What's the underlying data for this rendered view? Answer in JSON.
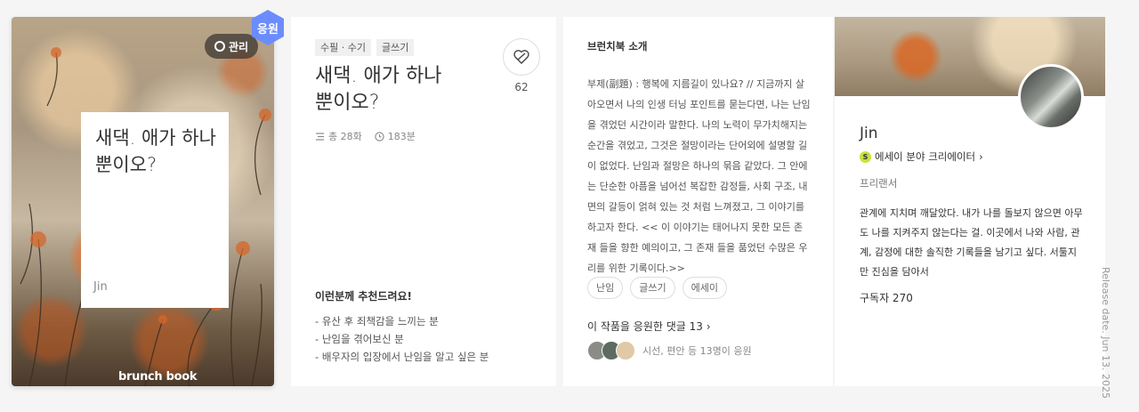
{
  "cover": {
    "manage_label": "관리",
    "support_badge": "응원",
    "title": "새댁. 애가 하나뿐이오?",
    "author": "Jin",
    "logo": "brunch book"
  },
  "book": {
    "tags": [
      "수필 · 수기",
      "글쓰기"
    ],
    "title": "새댁. 애가 하나뿐이오?",
    "episodes": "총 28화",
    "minutes": "183분",
    "like_count": "62",
    "rec_title": "이런분께 추천드려요!",
    "rec_items": [
      "유산 후 죄책감을 느끼는 분",
      "난임을 겪어보신 분",
      "배우자의 입장에서 난임을 알고 싶은 분"
    ]
  },
  "intro": {
    "title": "브런치북 소개",
    "text": "부제(副題) : 행복에 지름길이 있나요? // 지금까지 살아오면서 나의 인생 터닝 포인트를 묻는다면, 나는 난임을 겪었던 시간이라 말한다. 나의 노력이 무가치해지는 순간을 겪었고, 그것은 절망이라는 단어외에 설명할 길이 없었다. 난임과 절망은 하나의 묶음 같았다. 그 안에는 단순한 아픔을 넘어선 복잡한 감정들, 사회 구조, 내면의 갈등이 얽혀 있는 것 처럼 느껴졌고, 그 이야기를 하고자 한다. << 이 이야기는 태어나지 못한 모든 존재 들을 향한 예의이고, 그 존재 들을 품었던 수많은 우리를 위한 기록이다.>>",
    "keywords": [
      "난임",
      "글쓰기",
      "에세이"
    ],
    "comment_link": "이 작품을 응원한 댓글 13",
    "supporters_text": "시선, 편안 등 13명이 응원"
  },
  "author": {
    "name": "Jin",
    "creator": "에세이 분야 크리에이터",
    "creator_badge": "S",
    "job": "프리랜서",
    "bio": "관계에 지치며 깨달았다. 내가 나를 돌보지 않으면 아무도 나를 지켜주지 않는다는 걸. 이곳에서 나와 사람, 관계, 감정에 대한 솔직한 기록들을 남기고 싶다. 서툴지만 진심을 담아서",
    "subscribers": "구독자 270"
  },
  "release_date": "Release date. Jun 13. 2025",
  "colors": {
    "badge": "#6b8cff",
    "creator_badge": "#c6e23a"
  }
}
